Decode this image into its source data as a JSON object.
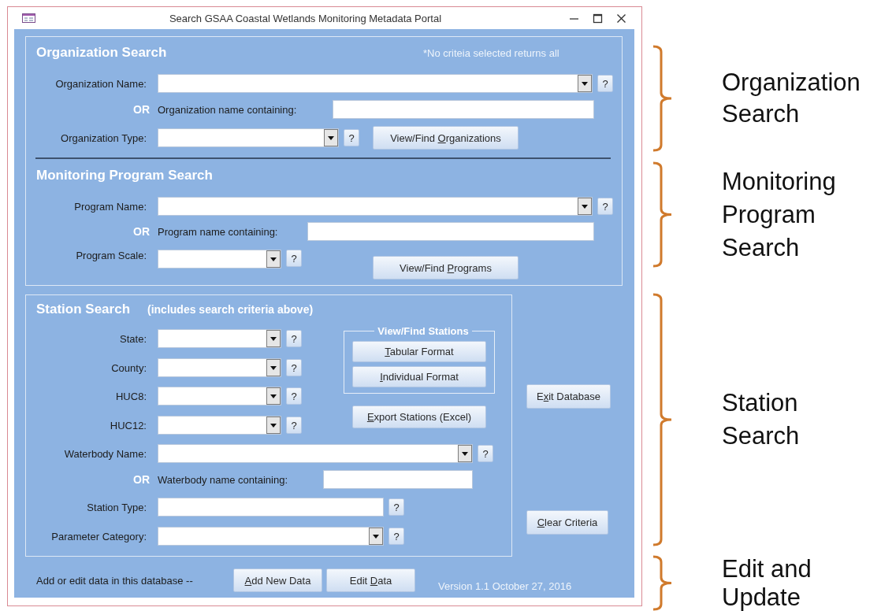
{
  "window": {
    "title": "Search GSAA Coastal Wetlands Monitoring Metadata Portal"
  },
  "organization_search": {
    "title": "Organization Search",
    "note": "*No criteia selected returns all",
    "fields": [
      {
        "kind": "combo",
        "label": "Organization Name:",
        "help": "?"
      },
      {
        "kind": "text",
        "or": "OR",
        "label": "Organization name containing:"
      },
      {
        "kind": "combo",
        "label": "Organization Type:",
        "help": "?"
      }
    ],
    "button": {
      "pre": "View/Find ",
      "key": "O",
      "post": "rganizations"
    }
  },
  "program_search": {
    "title": "Monitoring Program Search",
    "fields": [
      {
        "kind": "combo",
        "label": "Program Name:",
        "help": "?"
      },
      {
        "kind": "text",
        "or": "OR",
        "label": "Program name containing:"
      },
      {
        "kind": "combo",
        "label": "Program Scale:",
        "help": "?"
      }
    ],
    "button": {
      "pre": "View/Find ",
      "key": "P",
      "post": "rograms"
    }
  },
  "station_search": {
    "title": "Station Search",
    "subtitle": "(includes search criteria above)",
    "fields": [
      {
        "kind": "combo",
        "label": "State:",
        "help": "?"
      },
      {
        "kind": "combo",
        "label": "County:",
        "help": "?"
      },
      {
        "kind": "combo",
        "label": "HUC8:",
        "help": "?"
      },
      {
        "kind": "combo",
        "label": "HUC12:",
        "help": "?"
      },
      {
        "kind": "combo",
        "label": "Waterbody Name:",
        "help": "?"
      },
      {
        "kind": "text",
        "or": "OR",
        "label": "Waterbody name containing:"
      },
      {
        "kind": "text",
        "label": "Station Type:",
        "help": "?"
      },
      {
        "kind": "combo",
        "label": "Parameter Category:",
        "help": "?"
      }
    ],
    "view_find": {
      "title": "View/Find Stations",
      "buttons": [
        {
          "key": "T",
          "post": "abular Format"
        },
        {
          "key": "I",
          "post": "ndividual Format"
        }
      ]
    },
    "export_button": {
      "key": "E",
      "post": "xport Stations (Excel)"
    }
  },
  "exit_button": {
    "pre": "E",
    "key": "x",
    "post": "it Database"
  },
  "clear_button": {
    "key": "C",
    "post": "lear Criteria"
  },
  "footer": {
    "text": "Add or edit data in this database --",
    "buttons": [
      {
        "key": "A",
        "post": "dd New Data"
      },
      {
        "pre": "Edit ",
        "key": "D",
        "post": "ata"
      }
    ],
    "version": "Version 1.1  October 27, 2016"
  },
  "annotations": [
    {
      "label": "Organization Search"
    },
    {
      "label": "Monitoring Program Search"
    },
    {
      "label": "Station Search"
    },
    {
      "label": "Edit and Update"
    }
  ]
}
